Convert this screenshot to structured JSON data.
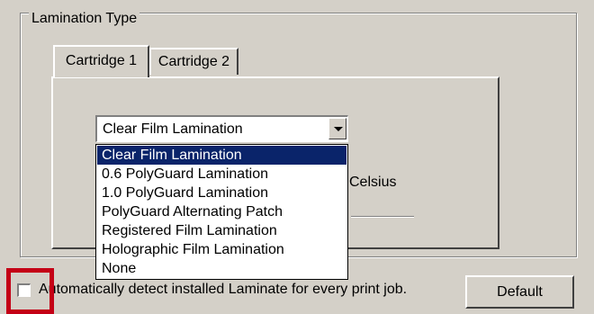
{
  "group": {
    "title": "Lamination Type"
  },
  "tabs": [
    {
      "label": "Cartridge 1",
      "selected": true
    },
    {
      "label": "Cartridge 2",
      "selected": false
    }
  ],
  "combo": {
    "value": "Clear Film Lamination"
  },
  "dropdown": {
    "options": [
      {
        "label": "Clear Film Lamination",
        "selected": true
      },
      {
        "label": "0.6 PolyGuard Lamination"
      },
      {
        "label": "1.0 PolyGuard Lamination"
      },
      {
        "label": "PolyGuard Alternating Patch"
      },
      {
        "label": "Registered Film Lamination"
      },
      {
        "label": "Holographic Film Lamination"
      },
      {
        "label": "None"
      }
    ]
  },
  "hidden_label": {
    "text": "Celsius"
  },
  "checkbox": {
    "label": "Automatically detect installed Laminate for every print job.",
    "checked": false
  },
  "default_button": {
    "label": "Default"
  },
  "colors": {
    "background": "#d4d0c8",
    "selection": "#0a246a",
    "highlight_box": "#c40016"
  }
}
